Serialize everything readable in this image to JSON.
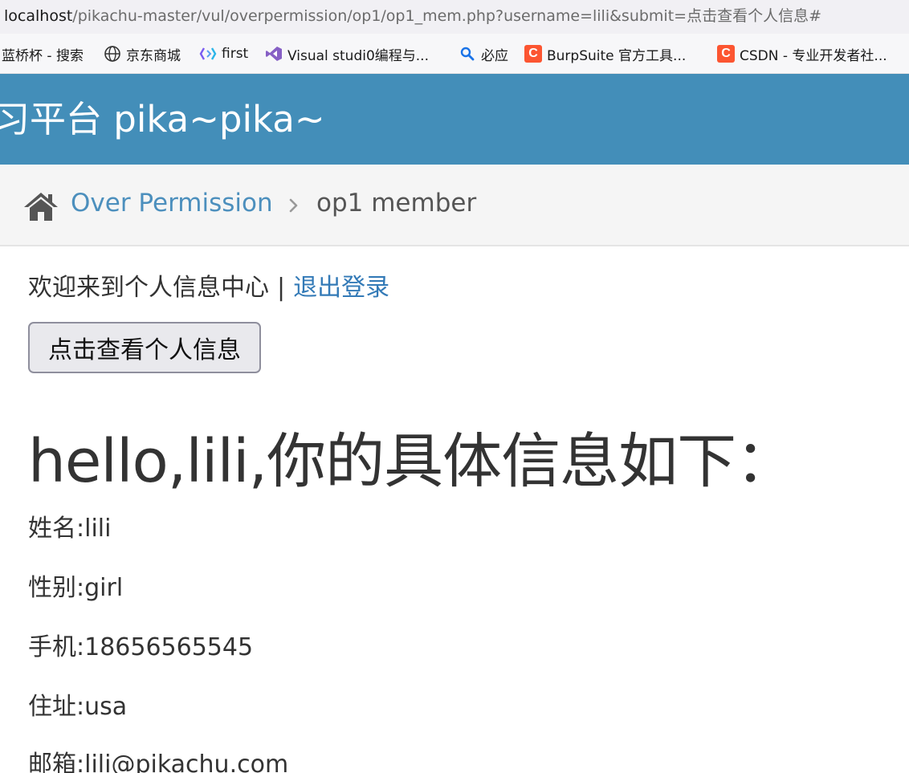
{
  "browser": {
    "url_host": "localhost",
    "url_rest": "/pikachu-master/vul/overpermission/op1/op1_mem.php?username=lili&submit=点击查看个人信息#",
    "bookmarks": [
      {
        "icon": "partial-icon",
        "label": "蓝桥杯 - 搜索"
      },
      {
        "icon": "globe-icon",
        "label": "京东商城"
      },
      {
        "icon": "diamond-logo-icon",
        "label": "first"
      },
      {
        "icon": "visual-studio-icon",
        "label": "Visual studi0编程与..."
      },
      {
        "icon": "search-icon",
        "label": "必应"
      },
      {
        "icon": "csdn-c-icon",
        "label": "BurpSuite 官方工具..."
      },
      {
        "icon": "csdn-c-icon",
        "label": "CSDN - 专业开发者社..."
      }
    ],
    "csdn_glyph": "C"
  },
  "header": {
    "title": "习平台 pika~pika~",
    "bg_color": "#438eb9"
  },
  "breadcrumb": {
    "link": "Over Permission",
    "current": "op1 member"
  },
  "main": {
    "welcome_text": "欢迎来到个人信息中心",
    "separator": "|",
    "logout_label": "退出登录",
    "view_button_label": "点击查看个人信息",
    "hello_heading": "hello,lili,你的具体信息如下：",
    "fields": [
      {
        "label": "姓名:lili"
      },
      {
        "label": "性别:girl"
      },
      {
        "label": "手机:18656565545"
      },
      {
        "label": "住址:usa"
      },
      {
        "label": "邮箱:lili@pikachu.com"
      }
    ]
  }
}
